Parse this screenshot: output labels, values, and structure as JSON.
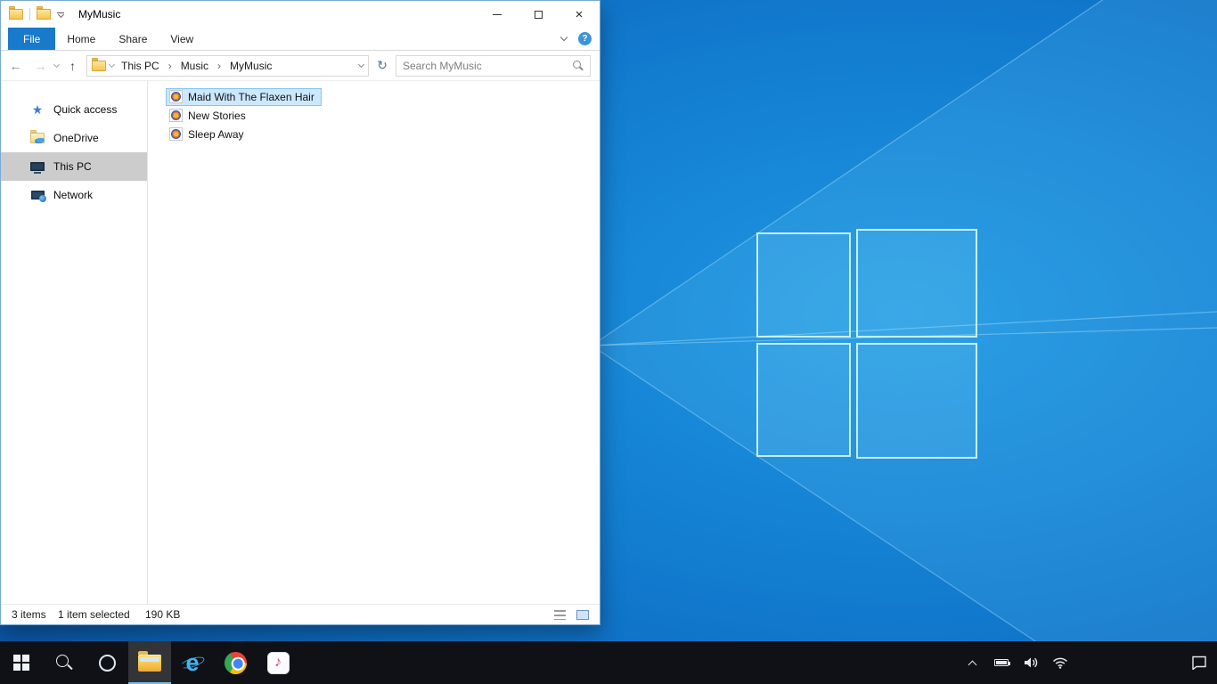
{
  "explorer": {
    "title": "MyMusic",
    "ribbon": {
      "tabs": [
        "File",
        "Home",
        "Share",
        "View"
      ],
      "active_tab": "File",
      "help_label": "?"
    },
    "address": {
      "crumbs": [
        "This PC",
        "Music",
        "MyMusic"
      ],
      "separator": "›"
    },
    "search": {
      "placeholder": "Search MyMusic"
    },
    "sidebar": [
      {
        "label": "Quick access",
        "icon": "star-icon",
        "selected": false
      },
      {
        "label": "OneDrive",
        "icon": "onedrive-icon",
        "selected": false
      },
      {
        "label": "This PC",
        "icon": "computer-icon",
        "selected": true
      },
      {
        "label": "Network",
        "icon": "network-icon",
        "selected": false
      }
    ],
    "files": [
      {
        "name": "Maid With The Flaxen Hair",
        "icon": "media-file-icon",
        "selected": true
      },
      {
        "name": "New Stories",
        "icon": "media-file-icon",
        "selected": false
      },
      {
        "name": "Sleep Away",
        "icon": "media-file-icon",
        "selected": false
      }
    ],
    "statusbar": {
      "count": "3 items",
      "selection": "1 item selected",
      "size": "190 KB"
    }
  },
  "icons": {
    "back": "←",
    "forward": "→",
    "up": "↑",
    "refresh": "↻",
    "close": "×",
    "star": "★",
    "note": "♪",
    "ie": "e"
  },
  "taskbar": {
    "buttons": [
      "start",
      "search",
      "cortana",
      "file-explorer",
      "internet-explorer",
      "chrome",
      "itunes"
    ],
    "active_button": "file-explorer",
    "tray": [
      "hidden-icons-chevron",
      "battery",
      "volume",
      "network",
      "action-center"
    ]
  },
  "colors": {
    "accent": "#1979ca",
    "file_selection_bg": "#cce8ff",
    "file_selection_border": "#84c5f2",
    "sidebar_selection": "#cccccc",
    "taskbar_bg": "#0f1116",
    "desktop_blue": "#1178cd"
  }
}
